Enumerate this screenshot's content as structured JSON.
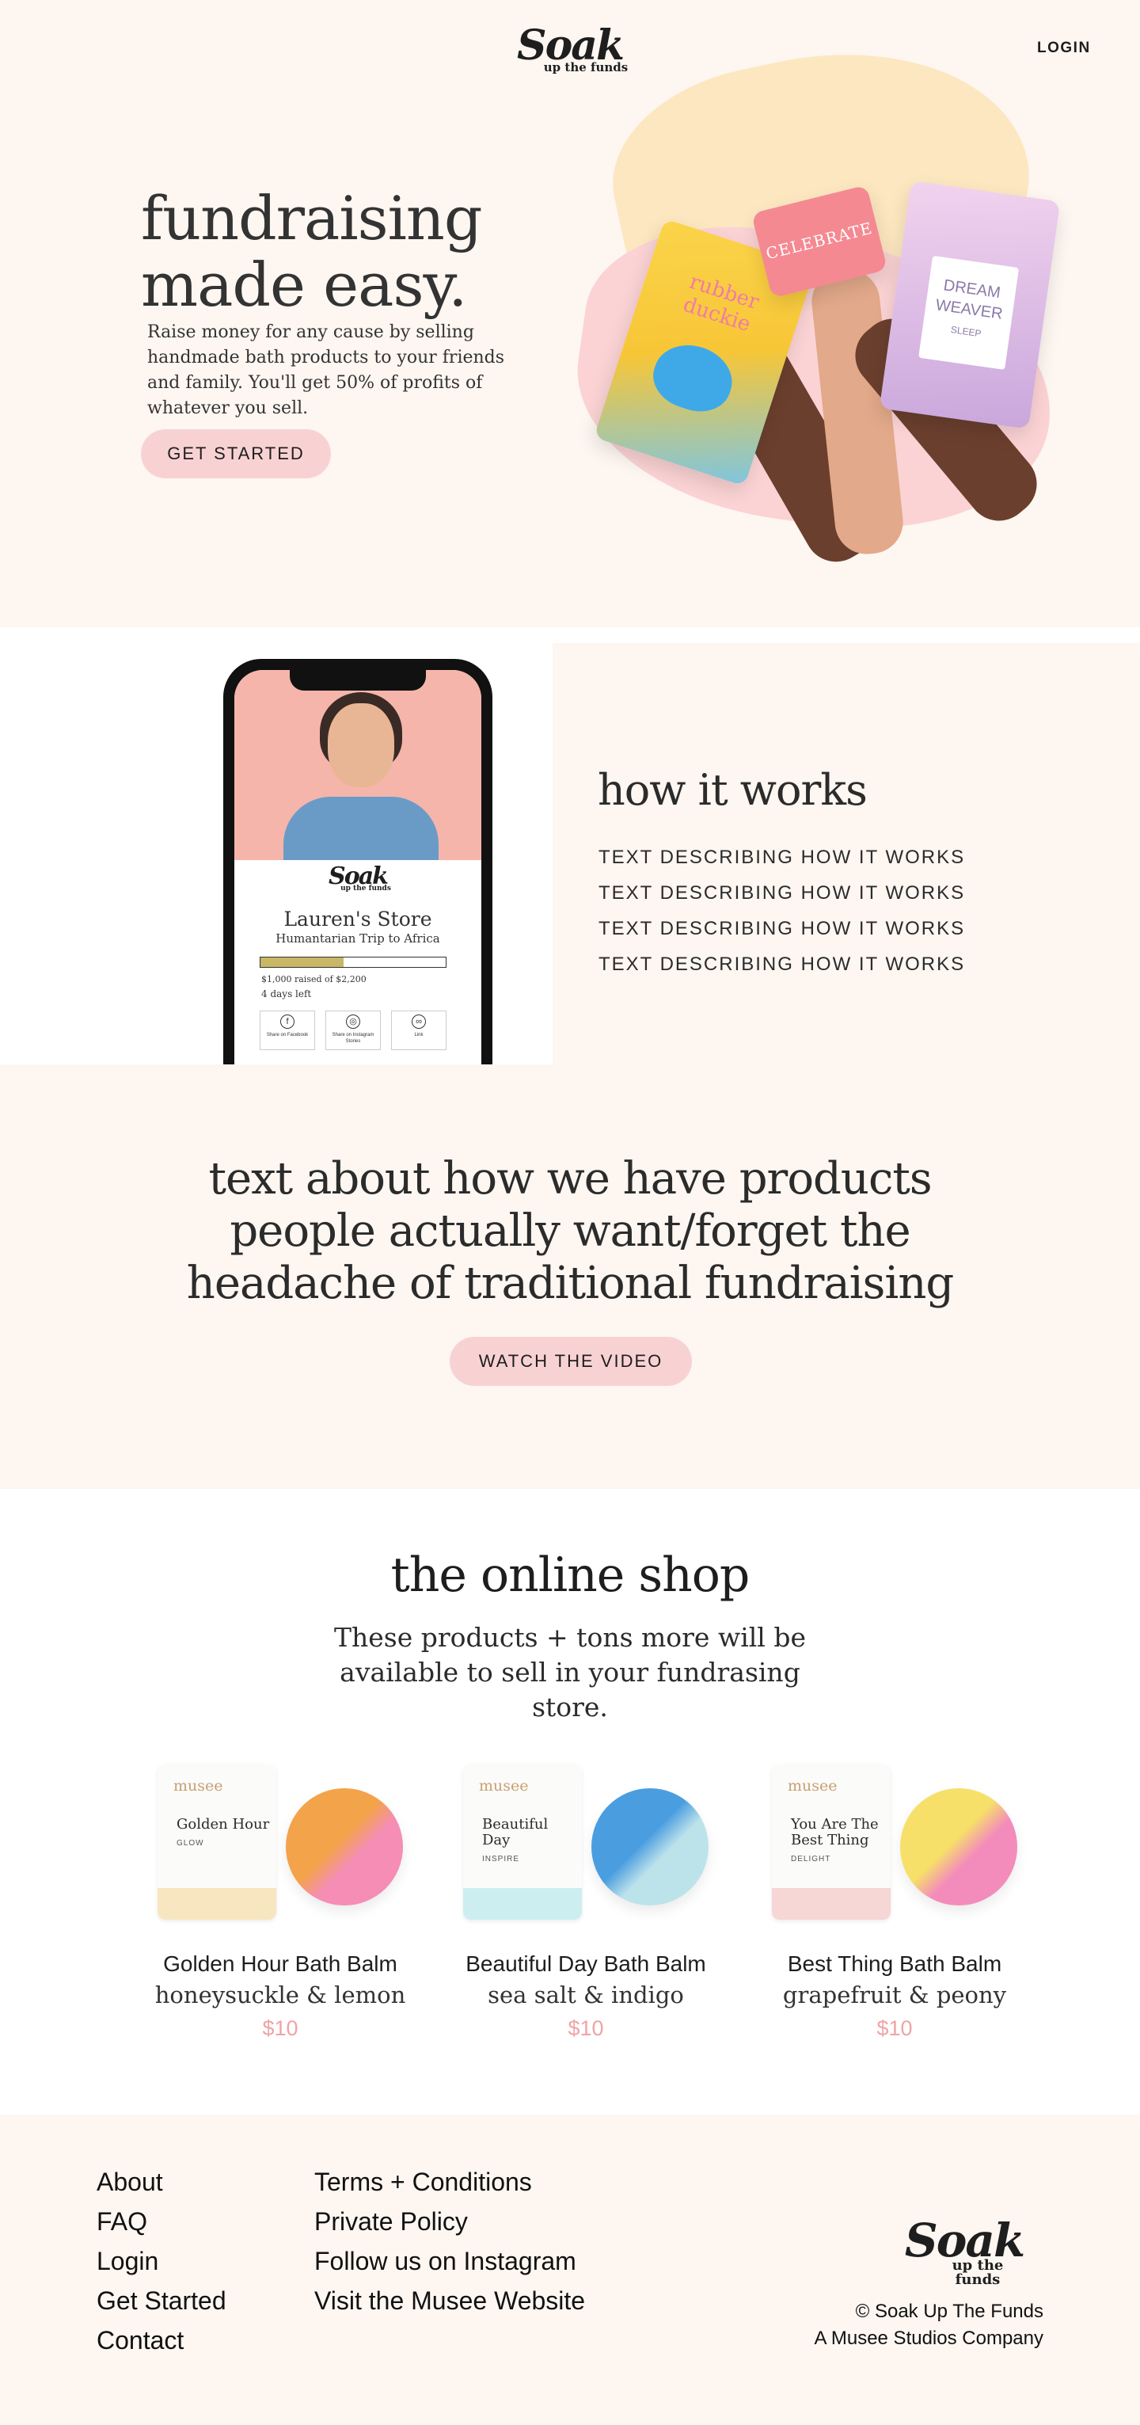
{
  "header": {
    "logo_script": "Soak",
    "logo_sub": "up the funds",
    "login_label": "LOGIN"
  },
  "hero": {
    "title_line1": "fundraising",
    "title_line2": "made easy.",
    "body": "Raise money for any cause by selling handmade bath products to your friends and family. You'll get 50% of profits of whatever you sell.",
    "cta_label": "GET STARTED",
    "products": [
      {
        "label": "rubber duckie"
      },
      {
        "label": "CELEBRATE"
      },
      {
        "label_line1": "DREAM",
        "label_line2": "WEAVER",
        "label_line3": "SLEEP"
      }
    ]
  },
  "how": {
    "title": "how it works",
    "steps": [
      "TEXT DESCRIBING HOW IT WORKS",
      "TEXT DESCRIBING HOW IT WORKS",
      "TEXT DESCRIBING HOW IT WORKS",
      "TEXT DESCRIBING HOW IT WORKS"
    ],
    "phone": {
      "logo_script": "Soak",
      "logo_sub": "up the funds",
      "store_name": "Lauren's Store",
      "store_sub": "Humantarian Trip to Africa",
      "progress_fraction": 0.45,
      "raised": "$1,000 raised of $2,200",
      "days_left": "4 days left",
      "share": [
        {
          "icon": "facebook-icon",
          "glyph": "f",
          "label": "Share on Facebook"
        },
        {
          "icon": "instagram-icon",
          "glyph": "◎",
          "label": "Share on Instagram Stories"
        },
        {
          "icon": "link-icon",
          "glyph": "∞",
          "label": "Link"
        }
      ]
    }
  },
  "promo": {
    "text": "text about how we have products people actually want/forget the headache of traditional fundraising",
    "cta_label": "WATCH THE VIDEO"
  },
  "shop": {
    "title": "the online shop",
    "subtitle": "These products + tons more will be available to sell in your fundrasing store.",
    "products": [
      {
        "name": "Golden Hour Bath Balm",
        "scent": "honeysuckle & lemon",
        "price": "$10",
        "brand": "musee",
        "tube_name": "Golden Hour",
        "tube_tag": "GLOW",
        "band_color": "#f7e6c0",
        "ball_colors": [
          "#f3a34a",
          "#f58db5"
        ]
      },
      {
        "name": "Beautiful Day Bath Balm",
        "scent": "sea salt & indigo",
        "price": "$10",
        "brand": "musee",
        "tube_name": "Beautiful Day",
        "tube_tag": "INSPIRE",
        "band_color": "#cdeef0",
        "ball_colors": [
          "#4a9ee0",
          "#bde3ea"
        ]
      },
      {
        "name": "Best Thing Bath Balm",
        "scent": "grapefruit & peony",
        "price": "$10",
        "brand": "musee",
        "tube_name": "You Are The Best Thing",
        "tube_tag": "DELIGHT",
        "band_color": "#f7d6d6",
        "ball_colors": [
          "#f6e06a",
          "#f38cbb"
        ]
      }
    ]
  },
  "footer": {
    "col1": [
      "About",
      "FAQ",
      "Login",
      "Get Started",
      "Contact"
    ],
    "col2": [
      "Terms + Conditions",
      "Private Policy",
      "Follow us on Instagram",
      "Visit the Musee Website"
    ],
    "logo_script": "Soak",
    "logo_sub": "up the funds",
    "copyright": "© Soak Up The Funds",
    "company": "A Musee Studios Company"
  },
  "colors": {
    "cream": "#fdf6f1",
    "pink_button": "#f8d2d3",
    "price_pink": "#f0a3a5",
    "progress_gold": "#c7b766"
  }
}
